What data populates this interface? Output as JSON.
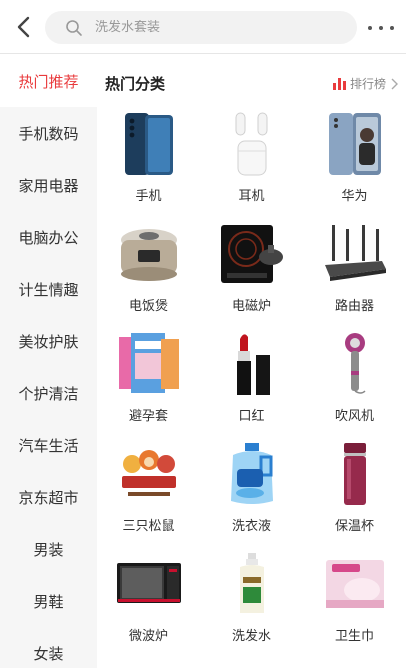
{
  "header": {
    "search_placeholder": "洗发水套装"
  },
  "sidebar": {
    "items": [
      {
        "label": "热门推荐",
        "active": true
      },
      {
        "label": "手机数码"
      },
      {
        "label": "家用电器"
      },
      {
        "label": "电脑办公"
      },
      {
        "label": "计生情趣"
      },
      {
        "label": "美妆护肤"
      },
      {
        "label": "个护清洁"
      },
      {
        "label": "汽车生活"
      },
      {
        "label": "京东超市"
      },
      {
        "label": "男装"
      },
      {
        "label": "男鞋"
      },
      {
        "label": "女装"
      }
    ]
  },
  "main": {
    "section_title": "热门分类",
    "rank_label": "排行榜",
    "products": [
      {
        "label": "手机",
        "icon": "phone-icon"
      },
      {
        "label": "耳机",
        "icon": "earbuds-icon"
      },
      {
        "label": "华为",
        "icon": "huawei-phone-icon"
      },
      {
        "label": "电饭煲",
        "icon": "rice-cooker-icon"
      },
      {
        "label": "电磁炉",
        "icon": "induction-cooker-icon"
      },
      {
        "label": "路由器",
        "icon": "router-icon"
      },
      {
        "label": "避孕套",
        "icon": "condom-box-icon"
      },
      {
        "label": "口红",
        "icon": "lipstick-icon"
      },
      {
        "label": "吹风机",
        "icon": "hair-dryer-icon"
      },
      {
        "label": "三只松鼠",
        "icon": "three-squirrels-logo"
      },
      {
        "label": "洗衣液",
        "icon": "detergent-bottle-icon"
      },
      {
        "label": "保温杯",
        "icon": "thermos-icon"
      },
      {
        "label": "微波炉",
        "icon": "microwave-icon"
      },
      {
        "label": "洗发水",
        "icon": "shampoo-bottle-icon"
      },
      {
        "label": "卫生巾",
        "icon": "sanitary-pad-icon"
      }
    ]
  },
  "colors": {
    "accent": "#e93b3d",
    "sidebar_bg": "#f6f6f6"
  }
}
